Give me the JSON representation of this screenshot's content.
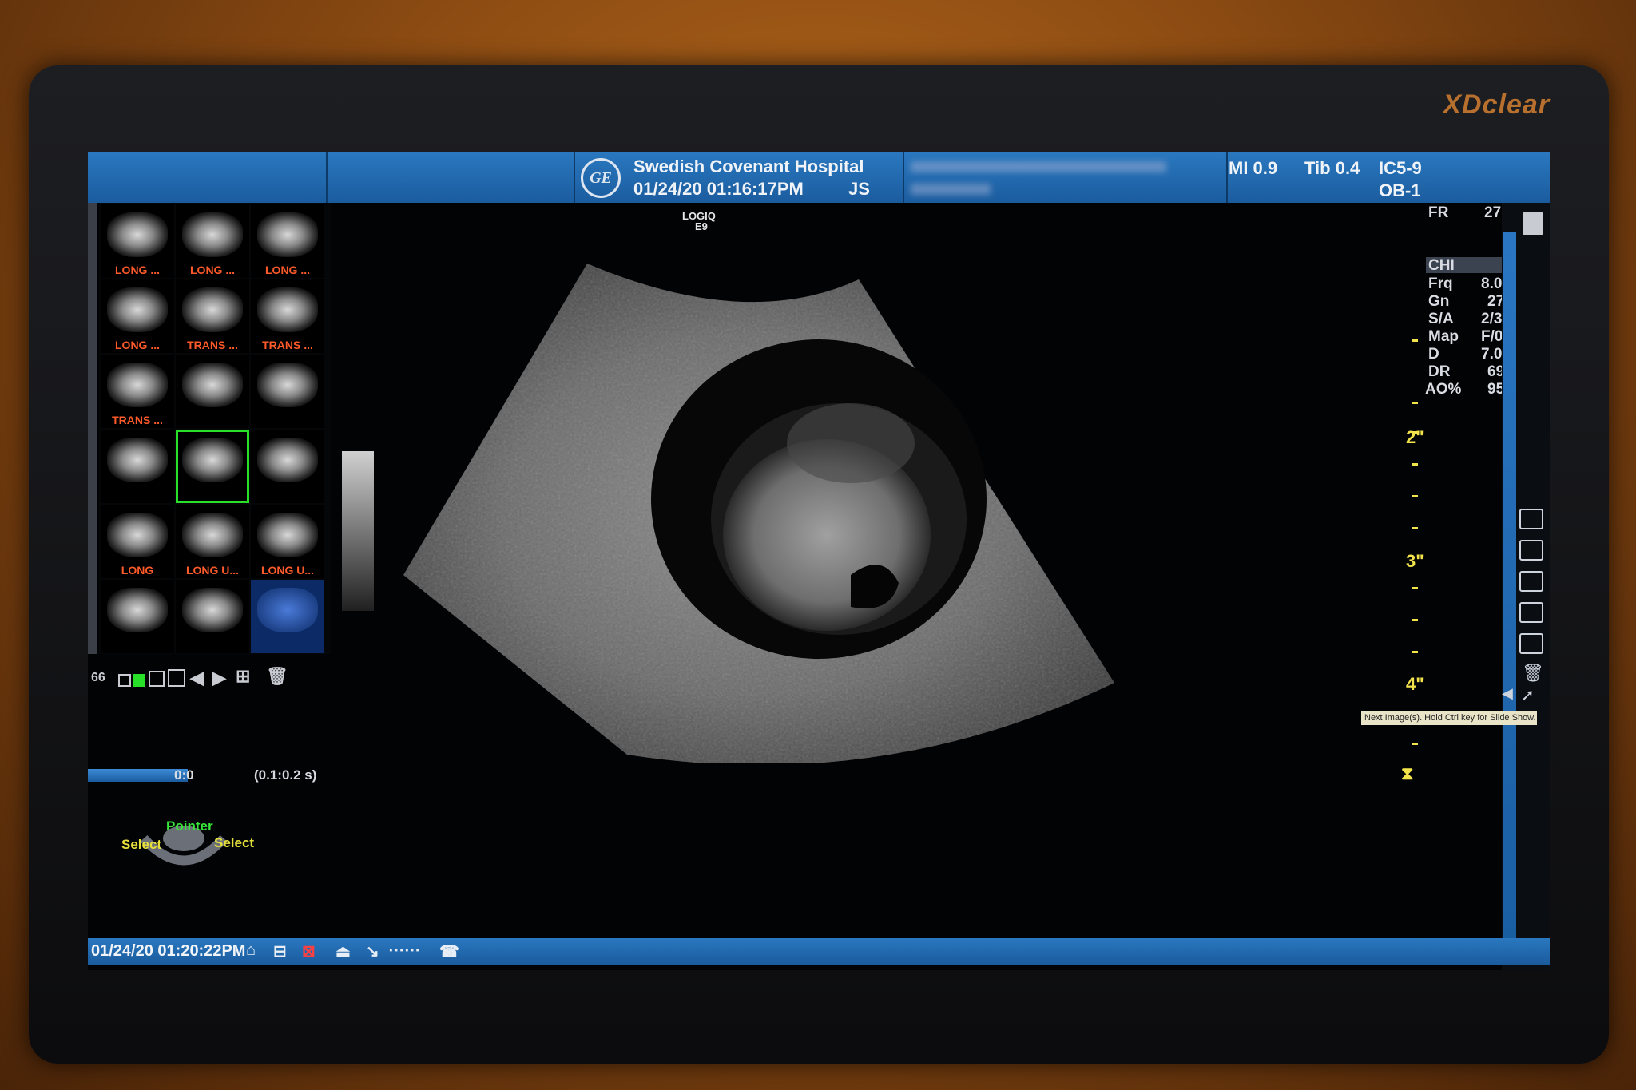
{
  "monitor": {
    "brand": "XDclear"
  },
  "header": {
    "logo": "GE",
    "hospital": "Swedish Covenant Hospital",
    "datetime": "01/24/20 01:16:17PM",
    "operator": "JS",
    "mi": "MI 0.9",
    "tib": "Tib 0.4",
    "probe": "IC5-9",
    "preset": "OB-1"
  },
  "thumbnails": [
    {
      "label": "LONG ..."
    },
    {
      "label": "LONG ..."
    },
    {
      "label": "LONG ..."
    },
    {
      "label": "LONG ..."
    },
    {
      "label": "TRANS ..."
    },
    {
      "label": "TRANS ..."
    },
    {
      "label": "TRANS ..."
    },
    {
      "label": ""
    },
    {
      "label": ""
    },
    {
      "label": ""
    },
    {
      "label": ""
    },
    {
      "label": ""
    },
    {
      "label": "LONG"
    },
    {
      "label": "LONG U..."
    },
    {
      "label": "LONG U..."
    },
    {
      "label": ""
    },
    {
      "label": ""
    },
    {
      "label": ""
    }
  ],
  "toolbar": {
    "count": "66"
  },
  "cine": {
    "position": "0:0",
    "range": "(0.1:0.2 s)"
  },
  "trackball": {
    "top": "Pointer",
    "left": "Select",
    "right": "Select"
  },
  "image": {
    "system": "LOGIQ",
    "model": "E9"
  },
  "params": {
    "fr_label": "FR",
    "fr_value": "27",
    "mode": "CHI",
    "rows": [
      {
        "key": "Frq",
        "value": "8.0"
      },
      {
        "key": "Gn",
        "value": "27"
      },
      {
        "key": "S/A",
        "value": "2/3"
      },
      {
        "key": "Map",
        "value": "F/0"
      },
      {
        "key": "D",
        "value": "7.0"
      },
      {
        "key": "DR",
        "value": "69"
      },
      {
        "key": "AO%",
        "value": "95"
      }
    ]
  },
  "depth_scale": {
    "labels": [
      "2\"",
      "3\"",
      "4\""
    ]
  },
  "tooltip": "Next Image(s). Hold Ctrl key for Slide Show.",
  "status": {
    "datetime": "01/24/20 01:20:22PM"
  },
  "colors": {
    "header_blue": "#1f68b0",
    "accent_green": "#27e027",
    "label_orange": "#ff5a2a",
    "scale_yellow": "#f2e34b"
  }
}
